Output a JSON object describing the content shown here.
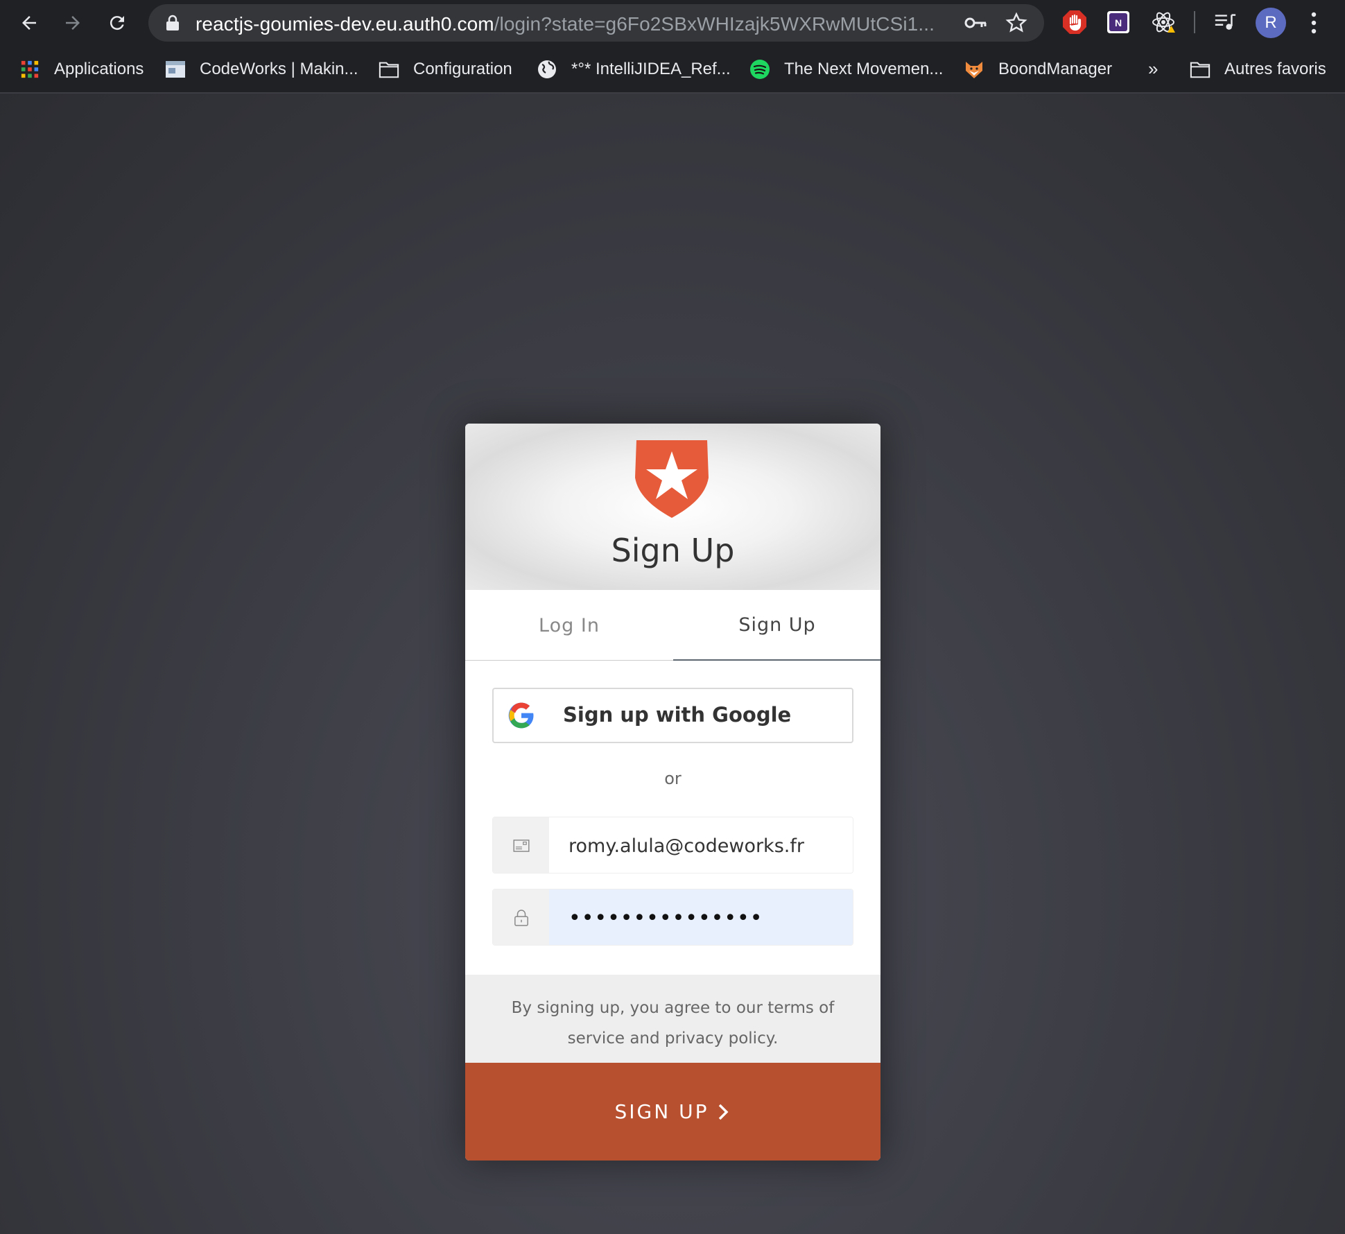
{
  "browser": {
    "url_host": "reactjs-goumies-dev.eu.auth0.com",
    "url_rest": "/login?state=g6Fo2SBxWHIzajk5WXRwMUtCSi1...",
    "avatar_initial": "R",
    "extensions": [
      "stop-hand-icon",
      "n-icon",
      "react-icon",
      "media-queue-icon"
    ]
  },
  "bookmarks": {
    "items": [
      {
        "label": "Applications",
        "icon": "apps-grid-icon"
      },
      {
        "label": "CodeWorks | Makin...",
        "icon": "codeworks-favicon"
      },
      {
        "label": "Configuration",
        "icon": "folder-icon"
      },
      {
        "label": "*°* IntelliJIDEA_Ref...",
        "icon": "globe-icon"
      },
      {
        "label": "The Next Movemen...",
        "icon": "spotify-icon"
      },
      {
        "label": "BoondManager",
        "icon": "fox-icon"
      }
    ],
    "more": "»",
    "other_label": "Autres favoris"
  },
  "widget": {
    "title": "Sign Up",
    "tabs": [
      {
        "label": "Log In",
        "active": false
      },
      {
        "label": "Sign Up",
        "active": true
      }
    ],
    "google_label": "Sign up with Google",
    "or_label": "or",
    "email_value": "romy.alula@codeworks.fr",
    "password_value": "•••••••••••••••",
    "terms": "By signing up, you agree to our terms of service and privacy policy.",
    "submit_label": "SIGN UP"
  },
  "colors": {
    "accent": "#b6502f",
    "logo": "#e65c3a",
    "chrome_bg": "#202124"
  }
}
